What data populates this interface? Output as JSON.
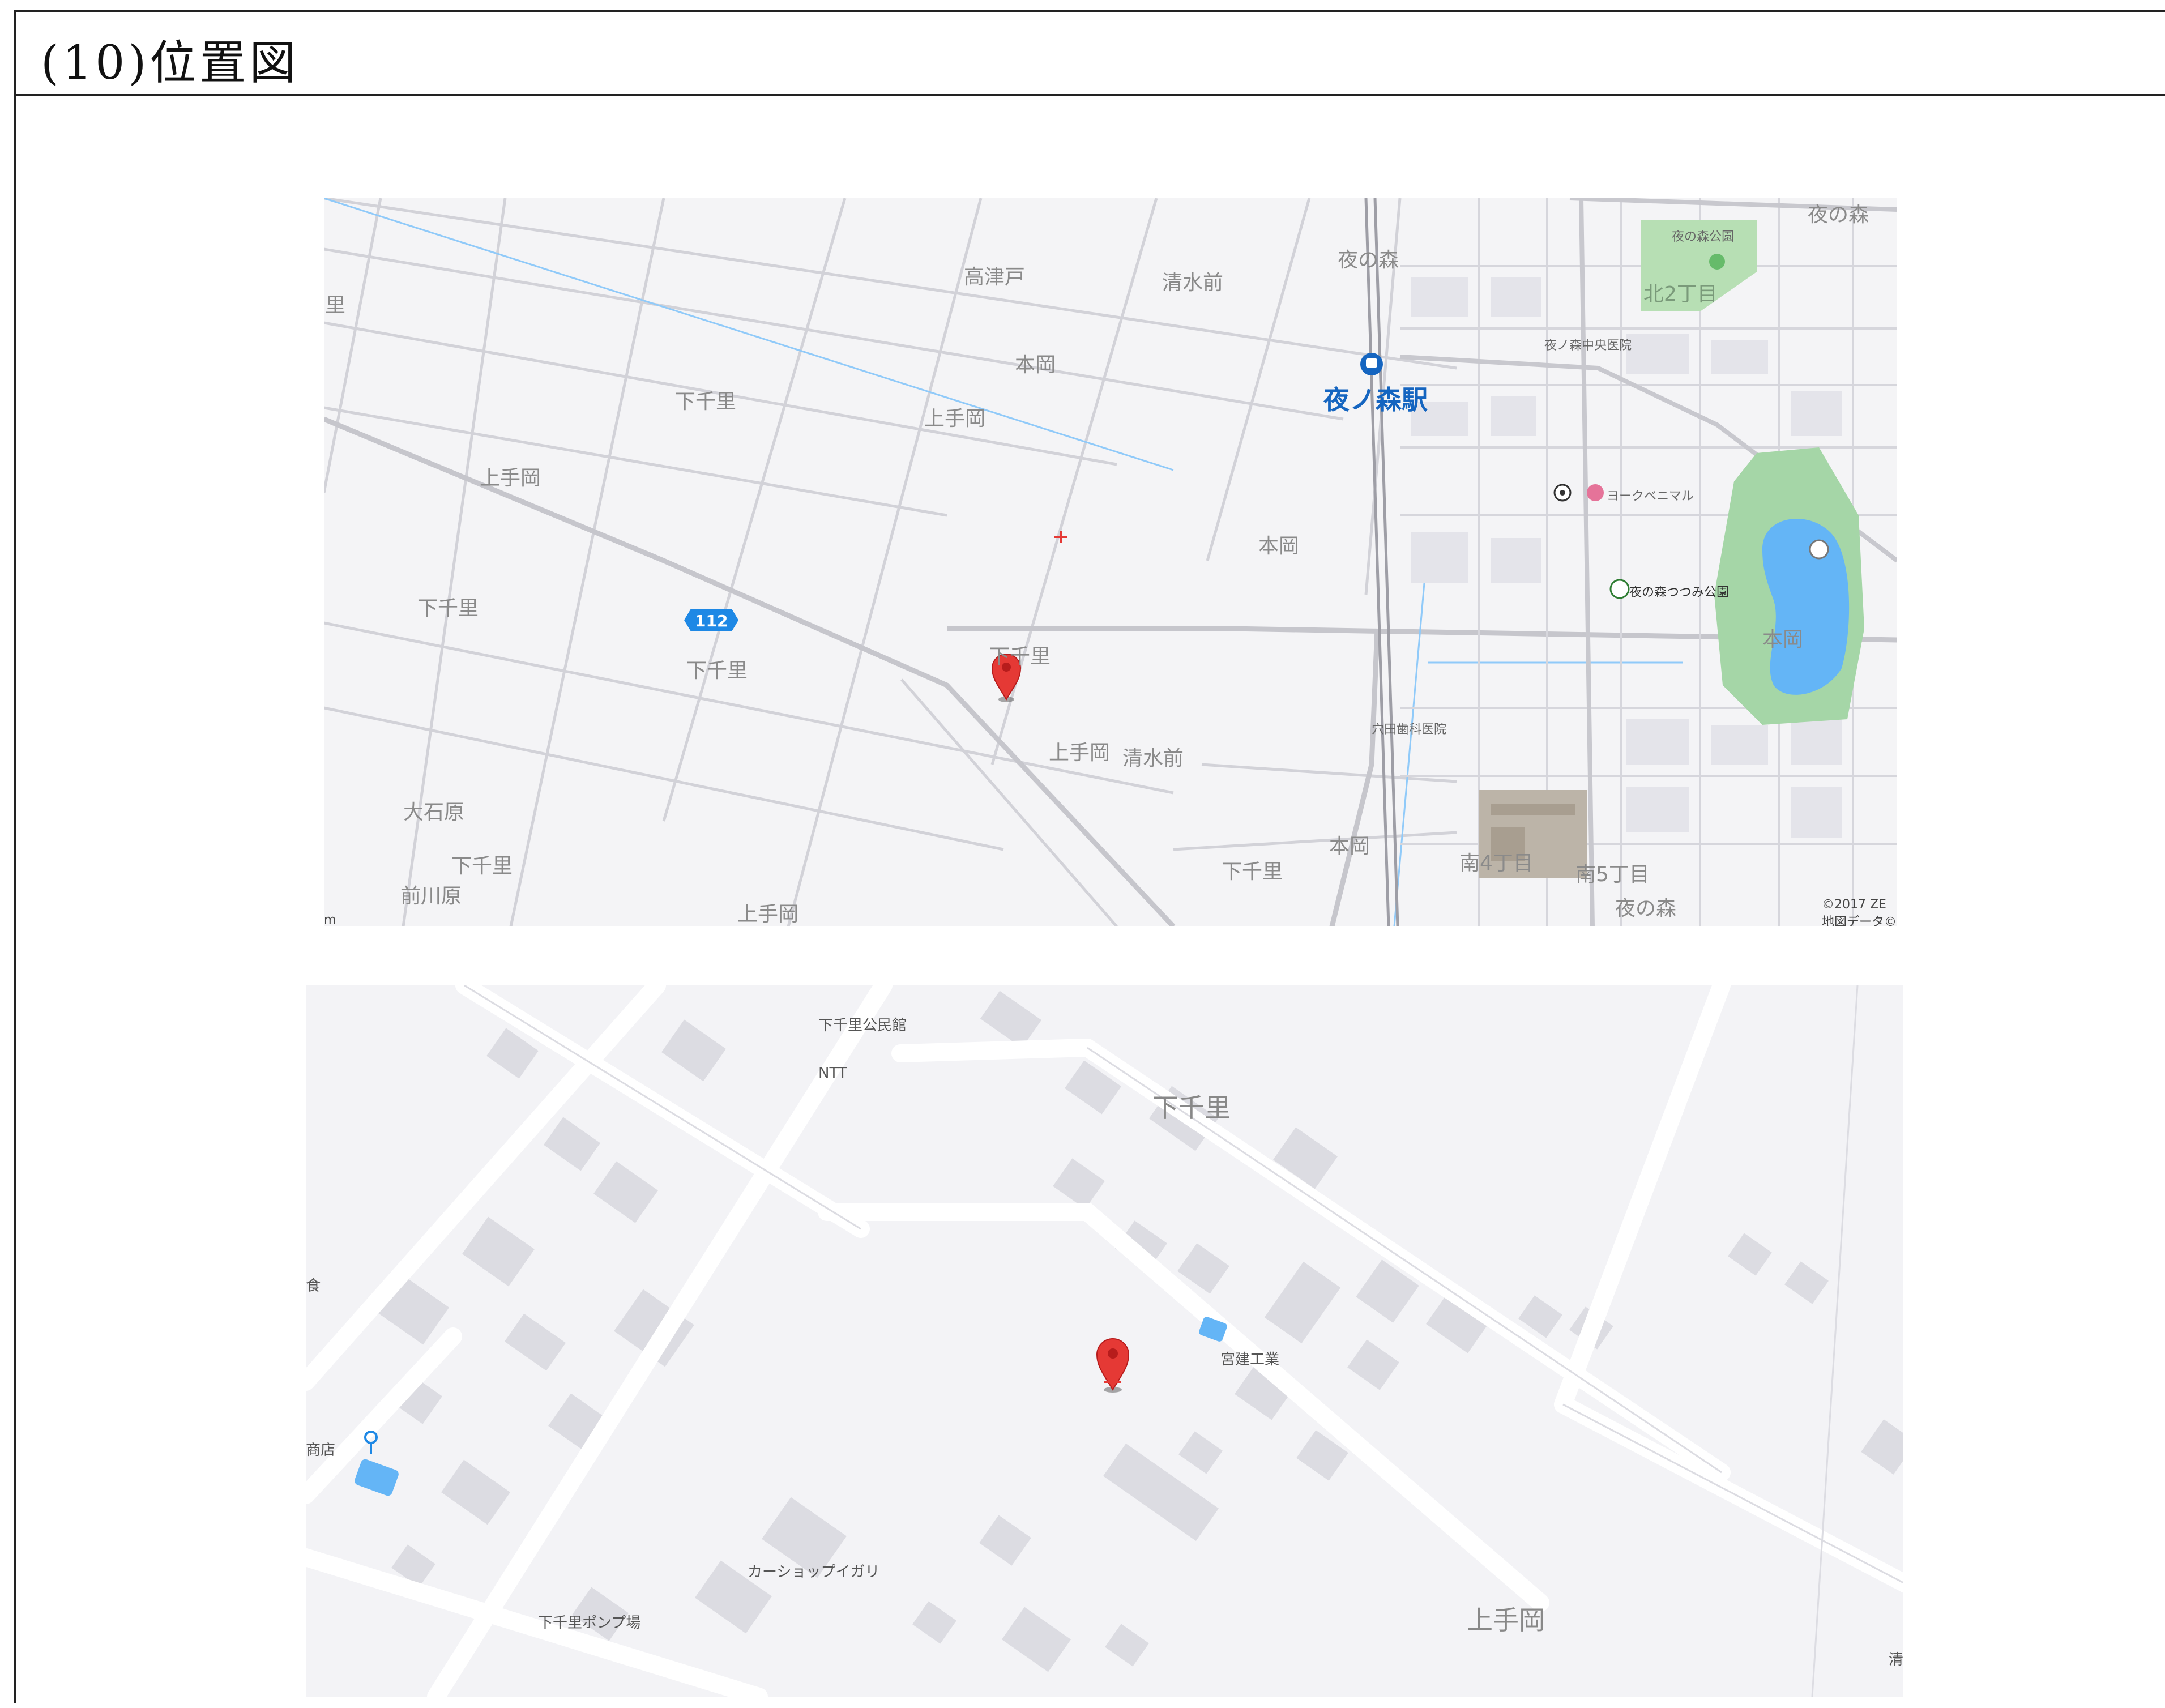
{
  "title": "(10)位置図",
  "colors": {
    "marker": "#e53935",
    "water": "#64b5f6",
    "park": "#a5d6a7",
    "station": "#1565c0",
    "route": "#1e88e5"
  },
  "map1": {
    "labels": {
      "sato_edge": "里",
      "takatsudo": "高津戸",
      "shimizumae1": "清水前",
      "yorunomori1": "夜の森",
      "yorunomori_top": "夜の森",
      "hongou1": "本岡",
      "kamitekoka1": "上手岡",
      "shimochisato1": "下千里",
      "kamitekoka2": "上手岡",
      "hongou2": "本岡",
      "shimochisato2": "下千里",
      "shimochisato3": "下千里",
      "shimochisato4": "下千里",
      "kamitekoka3": "上手岡",
      "shimizumae2": "清水前",
      "oishihara": "大石原",
      "shimochisato5": "下千里",
      "maekawahara": "前川原",
      "kamitekoka4": "上手岡",
      "shimochisato6": "下千里",
      "hongou3": "本岡",
      "station": "夜ノ森駅",
      "hospital": "夜ノ森中央医院",
      "park1": "夜の森公園",
      "kita2": "北2丁目",
      "yorkbenimaru": "ヨークベニマル",
      "park2": "夜の森つつみ公園",
      "hongou4": "本岡",
      "dental": "穴田歯科医院",
      "minami4": "南4丁目",
      "minami5": "南5丁目",
      "yorunomori2": "夜の森",
      "route": "112",
      "copyright1": "©2017 ZE",
      "copyright2": "地図データ©",
      "scale_edge": "m"
    }
  },
  "map2": {
    "labels": {
      "kominkan": "下千里公民館",
      "ntt": "NTT",
      "shimochisato": "下千里",
      "miyatake": "宮建工業",
      "shoten": "商店",
      "carshop": "カーショップイガリ",
      "pump": "下千里ポンプ場",
      "kamitekoka": "上手岡",
      "edge_left": "食",
      "edge_right": "清"
    }
  }
}
